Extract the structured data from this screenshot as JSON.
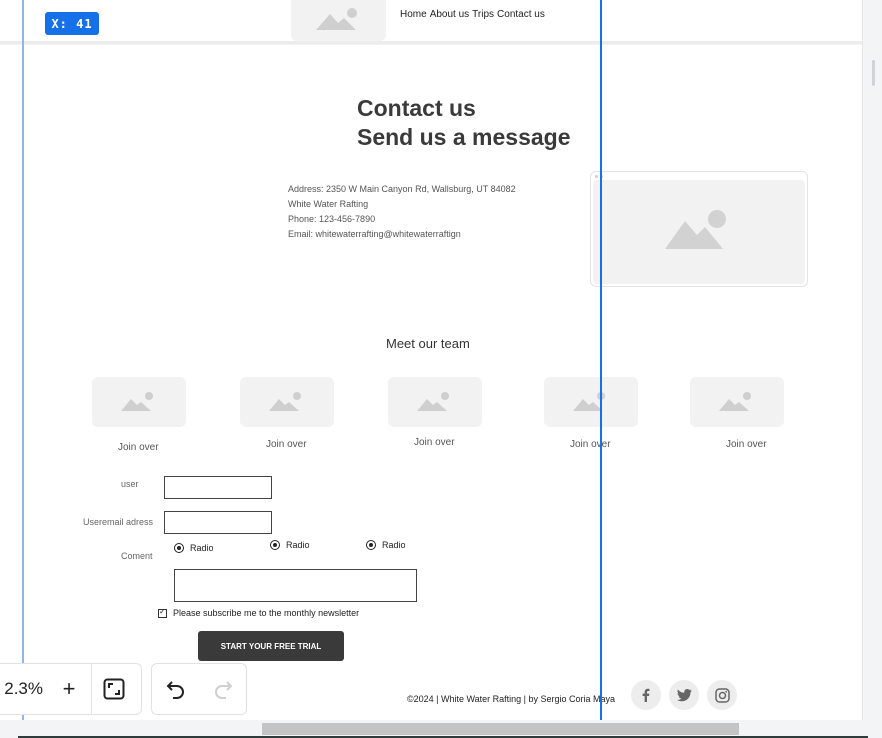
{
  "cursor_readout": "X: 41",
  "nav": {
    "items": [
      "Home",
      "About us",
      "Trips",
      "Contact us"
    ]
  },
  "hero": {
    "title_line1": "Contact us",
    "title_line2": "Send us a message"
  },
  "address": {
    "line1": "Address: 2350 W Main Canyon Rd, Wallsburg, UT 84082",
    "line2": "White Water Rafting",
    "line3": "Phone: 123-456-7890",
    "line4": "Email: whitewaterrafting@whitewaterraftign"
  },
  "team": {
    "title": "Meet our team",
    "members": [
      "Join over",
      "Join over",
      "Join over",
      "Join over",
      "Join over"
    ]
  },
  "form": {
    "user_label": "user",
    "email_label": "Useremail adress",
    "comment_label": "Coment",
    "radio_options": [
      "Radio",
      "Radio",
      "Radio"
    ],
    "checkbox_label": "Please subscribe me to the monthly newsletter",
    "cta_label": "START YOUR FREE TRIAL"
  },
  "footer": {
    "copyright": "©2024 | White Water Rafting | by Sergio Coria Maya",
    "social": [
      "facebook-icon",
      "twitter-icon",
      "instagram-icon"
    ]
  },
  "toolbar": {
    "zoom_value": "2.3%",
    "zoom_in_label": "+"
  },
  "colors": {
    "accent": "#1670e8",
    "guide": "#8fb6ef",
    "cta_bg": "#3a3a3a",
    "placeholder_bg": "#f2f2f2"
  }
}
